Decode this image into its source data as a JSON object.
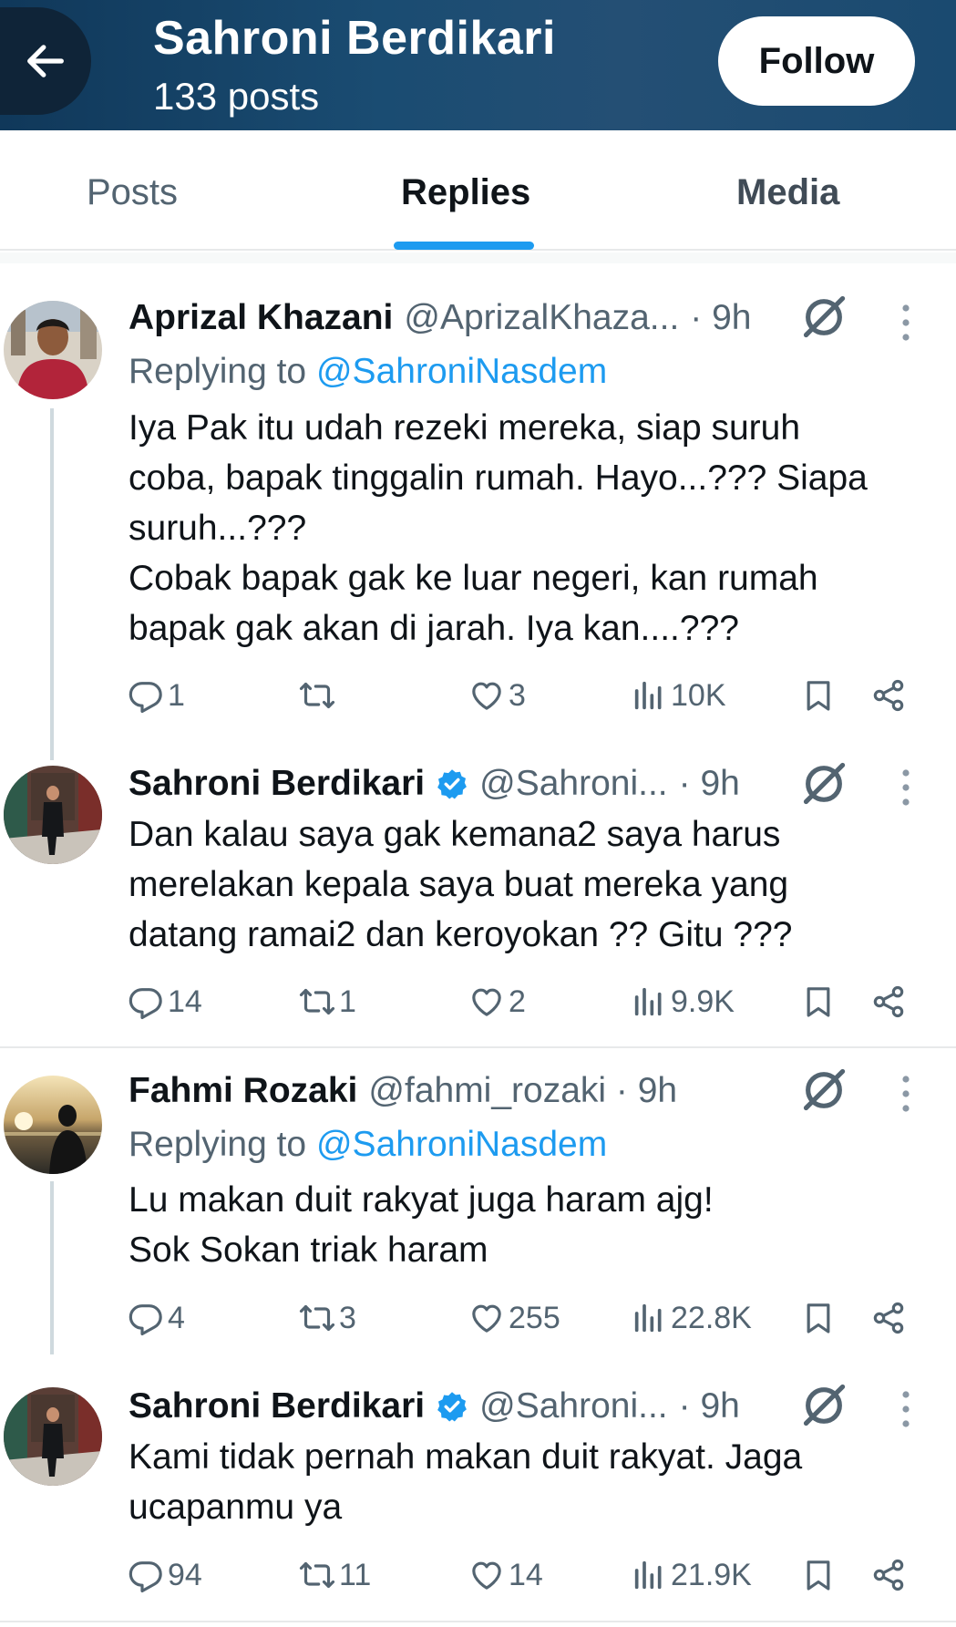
{
  "header": {
    "title": "Sahroni Berdikari",
    "subtitle": "133 posts",
    "follow_label": "Follow"
  },
  "tabs": [
    {
      "label": "Posts"
    },
    {
      "label": "Replies"
    },
    {
      "label": "Media"
    }
  ],
  "active_tab": "Replies",
  "colors": {
    "accent": "#1d9bf0",
    "header_bg": "#1a4a70",
    "secondary_text": "#536471",
    "verified": "#1d9bf0"
  },
  "tweets": [
    {
      "name": "Aprizal Khazani",
      "handle": "@AprizalKhaza...",
      "time": "· 9h",
      "verified": false,
      "replying_prefix": "Replying to",
      "replying_to": "@SahroniNasdem",
      "lines": [
        "Iya Pak itu udah rezeki mereka, siap suruh",
        "coba, bapak tinggalin rumah. Hayo...??? Siapa",
        "suruh...???",
        "Cobak bapak gak ke luar negeri, kan rumah",
        "bapak gak akan di jarah. Iya kan....???"
      ],
      "replies": "1",
      "reposts": "",
      "likes": "3",
      "views": "10K"
    },
    {
      "name": "Sahroni Berdikari",
      "handle": "@Sahroni...",
      "time": "· 9h",
      "verified": true,
      "lines": [
        "Dan kalau saya gak kemana2 saya harus",
        "merelakan kepala saya buat mereka yang",
        "datang ramai2 dan keroyokan ?? Gitu ???"
      ],
      "replies": "14",
      "reposts": "1",
      "likes": "2",
      "views": "9.9K"
    },
    {
      "name": "Fahmi Rozaki",
      "handle": "@fahmi_rozaki · 9h",
      "verified": false,
      "replying_prefix": "Replying to",
      "replying_to": "@SahroniNasdem",
      "lines": [
        "Lu makan duit rakyat juga haram ajg!",
        "Sok Sokan triak haram"
      ],
      "replies": "4",
      "reposts": "3",
      "likes": "255",
      "views": "22.8K"
    },
    {
      "name": "Sahroni Berdikari",
      "handle": "@Sahroni...",
      "time": "· 9h",
      "verified": true,
      "lines": [
        "Kami tidak pernah makan duit rakyat. Jaga",
        "ucapanmu ya"
      ],
      "replies": "94",
      "reposts": "11",
      "likes": "14",
      "views": "21.9K"
    }
  ],
  "icons": {
    "back": "arrow-left-icon",
    "verified": "verified-badge-icon",
    "grok": "grok-icon",
    "more": "more-dots-icon",
    "reply": "reply-icon",
    "repost": "repost-icon",
    "like": "heart-icon",
    "views": "views-icon",
    "bookmark": "bookmark-icon",
    "share": "share-icon"
  }
}
